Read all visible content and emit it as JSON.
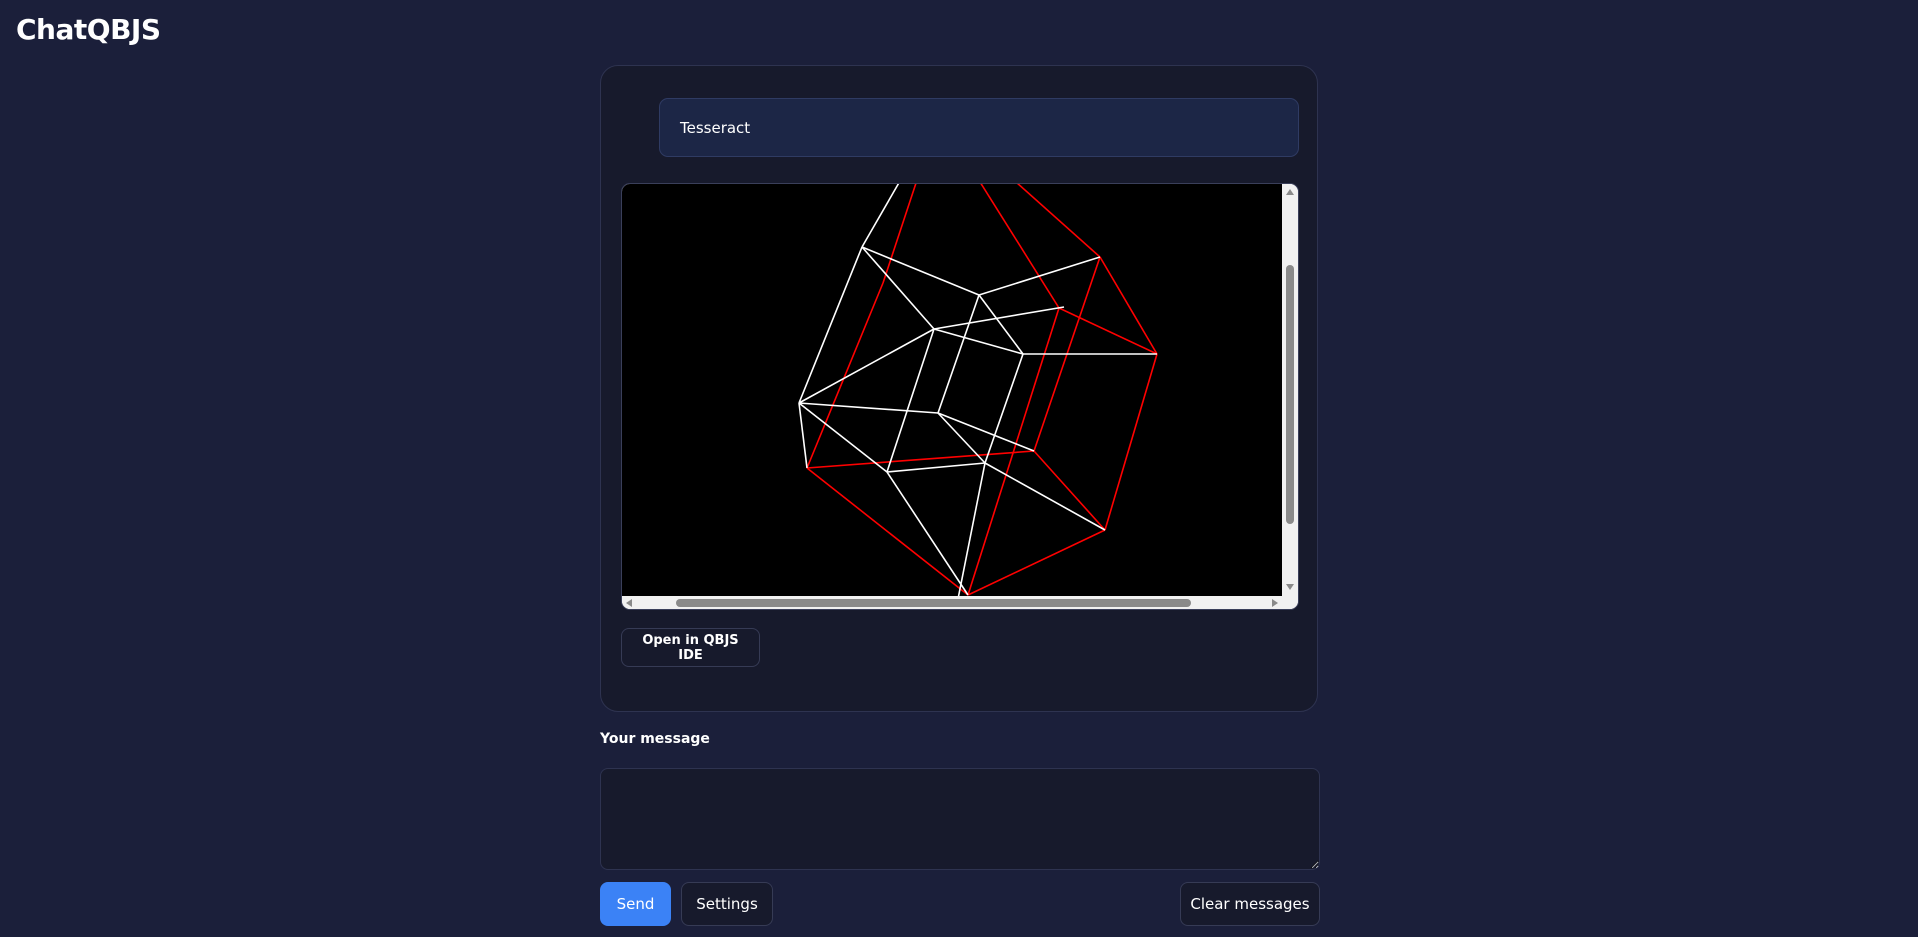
{
  "app": {
    "title": "ChatQBJS"
  },
  "conversation": {
    "user_message": "Tesseract",
    "program_output": {
      "description_icon": "tesseract-wireframe",
      "colors": {
        "inner_edges": "#ffffff",
        "outer_edges": "#ff0000",
        "background": "#000000"
      }
    },
    "open_ide_label": "Open in QBJS IDE"
  },
  "composer": {
    "label": "Your message",
    "value": "",
    "placeholder": "",
    "send_label": "Send",
    "settings_label": "Settings",
    "clear_label": "Clear messages"
  },
  "theme": {
    "background": "#1b1f3a",
    "panel": "#171a2c",
    "accent": "#3b82f6"
  }
}
